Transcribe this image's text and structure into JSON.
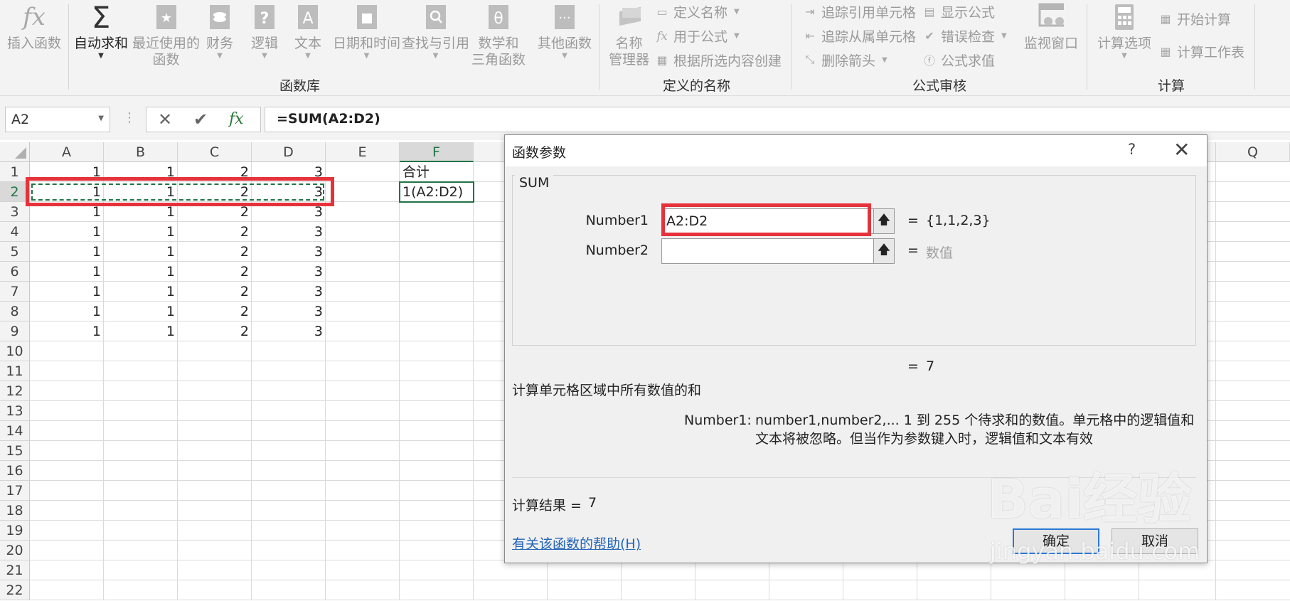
{
  "ribbon": {
    "function_library": {
      "group_label": "函数库",
      "insert_function": "插入函数",
      "autosum": "自动求和",
      "recently_used": "最近使用的\n函数",
      "financial": "财务",
      "logical": "逻辑",
      "text": "文本",
      "datetime": "日期和时间",
      "lookup": "查找与引用",
      "math_trig": "数学和\n三角函数",
      "more_functions": "其他函数"
    },
    "defined_names": {
      "group_label": "定义的名称",
      "name_manager": "名称\n管理器",
      "define_name": "定义名称",
      "use_in_formula": "用于公式",
      "create_from_selection": "根据所选内容创建"
    },
    "formula_auditing": {
      "group_label": "公式审核",
      "trace_precedents": "追踪引用单元格",
      "trace_dependents": "追踪从属单元格",
      "remove_arrows": "删除箭头",
      "show_formulas": "显示公式",
      "error_checking": "错误检查",
      "evaluate_formula": "公式求值",
      "watch_window": "监视窗口"
    },
    "calculation": {
      "group_label": "计算",
      "calc_options": "计算选项",
      "calc_now": "开始计算",
      "calc_sheet": "计算工作表"
    }
  },
  "formula_bar": {
    "name_box": "A2",
    "formula": "=SUM(A2:D2)"
  },
  "sheet": {
    "columns": [
      "A",
      "B",
      "C",
      "D",
      "E",
      "F",
      "Q"
    ],
    "rows": [
      "1",
      "2",
      "3",
      "4",
      "5",
      "6",
      "7",
      "8",
      "9",
      "10",
      "11",
      "12",
      "13",
      "14",
      "15",
      "16",
      "17",
      "18",
      "19",
      "20",
      "21",
      "22"
    ],
    "data": [
      [
        1,
        1,
        2,
        3
      ],
      [
        1,
        1,
        2,
        3
      ],
      [
        1,
        1,
        2,
        3
      ],
      [
        1,
        1,
        2,
        3
      ],
      [
        1,
        1,
        2,
        3
      ],
      [
        1,
        1,
        2,
        3
      ],
      [
        1,
        1,
        2,
        3
      ],
      [
        1,
        1,
        2,
        3
      ],
      [
        1,
        1,
        2,
        3
      ]
    ],
    "f1": "合计",
    "f2": "1(A2:D2)"
  },
  "dialog": {
    "title": "函数参数",
    "help_glyph": "?",
    "close_glyph": "✕",
    "function_name": "SUM",
    "arg1_label": "Number1",
    "arg1_value": "A2:D2",
    "arg1_result": "{1,1,2,3}",
    "arg2_label": "Number2",
    "arg2_value": "",
    "arg2_result": "数值",
    "equals": "=",
    "formula_result_inline": "7",
    "description": "计算单元格区域中所有数值的和",
    "arg_help_label": "Number1:",
    "arg_help_text": "number1,number2,... 1 到 255 个待求和的数值。单元格中的逻辑值和文本将被忽略。但当作为参数键入时，逻辑值和文本有效",
    "calc_result_label": "计算结果 =",
    "calc_result_value": "7",
    "help_link": "有关该函数的帮助(H)",
    "ok": "确定",
    "cancel": "取消"
  },
  "watermark": {
    "brand": "Bai经验",
    "url": "jingyan.baidu.com"
  }
}
